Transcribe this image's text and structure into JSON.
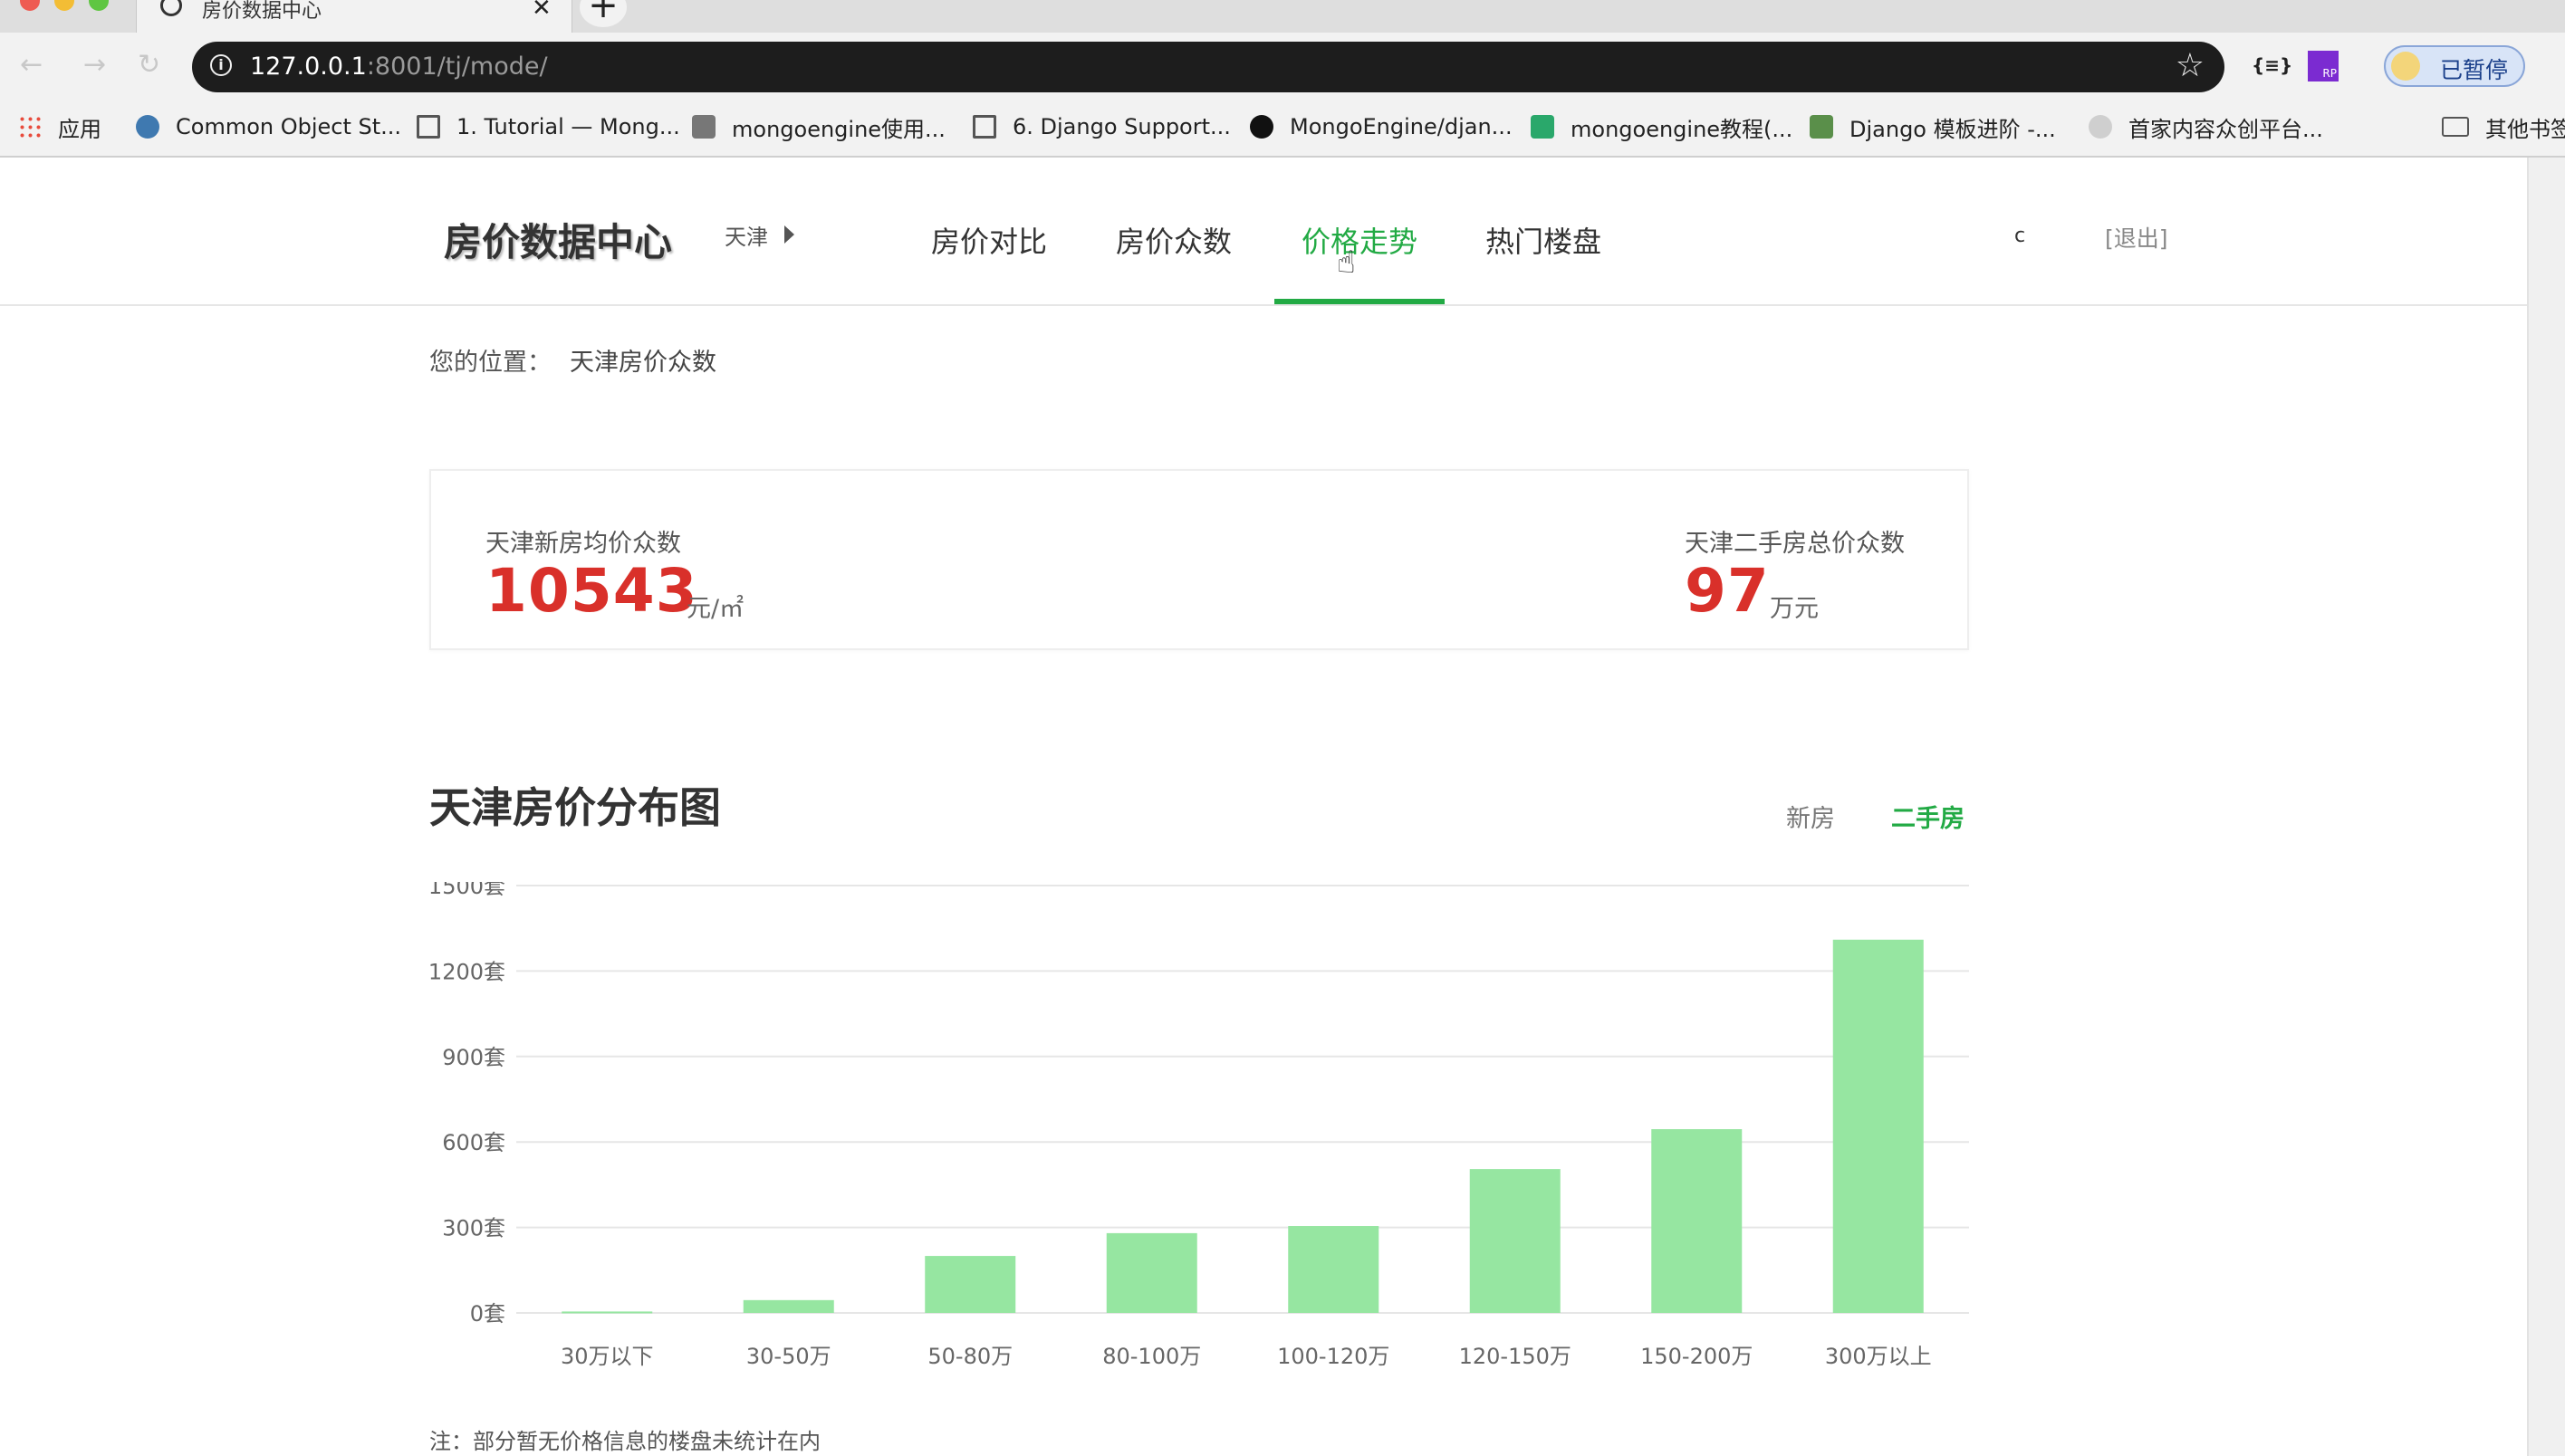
{
  "browser": {
    "tab_title": "房价数据中心",
    "tab_close": "✕",
    "new_tab": "+",
    "url_host": "127.0.0.1",
    "url_rest": ":8001/tj/mode/",
    "info_icon": "i",
    "star_icon": "☆",
    "ext_json": "{≡}",
    "ext_rp": "RP",
    "profile_label": "已暂停",
    "traffic_colors": [
      "#ee5b52",
      "#f3bd35",
      "#5fc642"
    ],
    "bookmarks": [
      {
        "label": "应用",
        "icon": "apps-grid-icon"
      },
      {
        "label": "Common Object St...",
        "icon": "python-icon"
      },
      {
        "label": "1. Tutorial — Mong...",
        "icon": "doc-icon"
      },
      {
        "label": "mongoengine使用...",
        "icon": "shield-icon"
      },
      {
        "label": "6. Django Support...",
        "icon": "doc-icon"
      },
      {
        "label": "MongoEngine/djan...",
        "icon": "github-icon"
      },
      {
        "label": "mongoengine教程(...",
        "icon": "z-icon"
      },
      {
        "label": "Django 模板进阶 -...",
        "icon": "image-icon"
      },
      {
        "label": "首家内容众创平台...",
        "icon": "globe-icon"
      }
    ],
    "other_bookmarks": "其他书签"
  },
  "site": {
    "logo": "房价数据中心",
    "city": "天津",
    "nav": [
      "房价对比",
      "房价众数",
      "价格走势",
      "热门楼盘"
    ],
    "nav_active_index": 2,
    "user_initial": "c",
    "logout": "[退出]",
    "accent_color": "#22aa44",
    "highlight_color": "#d9302a"
  },
  "breadcrumb": {
    "label": "您的位置：",
    "current": "天津房价众数"
  },
  "stats": {
    "new_label": "天津新房均价众数",
    "new_value": "10543",
    "new_unit": "元/㎡",
    "second_label": "天津二手房总价众数",
    "second_value": "97",
    "second_unit": "万元"
  },
  "chart_section": {
    "title": "天津房价分布图",
    "toggle_new": "新房",
    "toggle_second": "二手房",
    "toggle_active": "二手房",
    "note": "注：部分暂无价格信息的楼盘未统计在内"
  },
  "chart_data": {
    "type": "bar",
    "title": "天津房价分布图",
    "categories": [
      "30万以下",
      "30-50万",
      "50-80万",
      "80-100万",
      "100-120万",
      "120-150万",
      "150-200万",
      "300万以上"
    ],
    "values": [
      5,
      45,
      200,
      280,
      305,
      505,
      645,
      1310
    ],
    "ylim": [
      0,
      1500
    ],
    "yticks": [
      0,
      300,
      600,
      900,
      1200,
      1500
    ],
    "ytick_suffix": "套",
    "grid": true,
    "bar_color": "#96e6a1",
    "grid_color": "#e6e6e6"
  }
}
